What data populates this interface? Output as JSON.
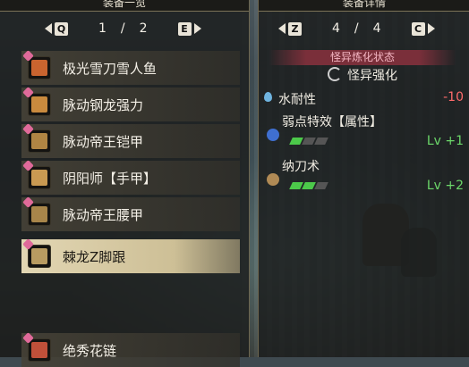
{
  "left_panel": {
    "title": "装备一览",
    "page_key_left": "Q",
    "page_key_right": "E",
    "page_current": "1",
    "page_sep": "/",
    "page_total": "2",
    "items": [
      {
        "label": "极光雪刀雪人鱼",
        "icon": "long-sword-icon",
        "color": "#c9642f"
      },
      {
        "label": "脉动钢龙强力",
        "icon": "helmet-icon",
        "color": "#c98a3e"
      },
      {
        "label": "脉动帝王铠甲",
        "icon": "chest-armor-icon",
        "color": "#b08544"
      },
      {
        "label": "阴阳师【手甲】",
        "icon": "gauntlet-icon",
        "color": "#c99a52"
      },
      {
        "label": "脉动帝王腰甲",
        "icon": "waist-armor-icon",
        "color": "#a8854a"
      },
      {
        "label": "棘龙Z脚跟",
        "icon": "leg-armor-icon",
        "color": "#b89b61"
      },
      {
        "label": "绝秀花链",
        "icon": "charm-icon",
        "color": "#c0503a"
      }
    ],
    "selected_index": 5
  },
  "right_panel": {
    "title": "装备详情",
    "page_key_left": "Z",
    "page_key_right": "C",
    "page_current": "4",
    "page_sep": "/",
    "page_total": "4",
    "status_caption": "怪异炼化状态",
    "mod_label": "怪异强化",
    "water_res_label": "水耐性",
    "water_res_value": "-10",
    "skills": [
      {
        "name": "弱点特效【属性】",
        "level": "Lv +1",
        "filled": 1,
        "total": 3,
        "icon": "bug-icon",
        "icon_color": "#3f6fd0"
      },
      {
        "name": "纳刀术",
        "level": "Lv +2",
        "filled": 2,
        "total": 3,
        "icon": "sheathe-icon",
        "icon_color": "#b08a55"
      }
    ]
  },
  "colors": {
    "accent_green": "#4cc94a",
    "level_text": "#6cd86a",
    "negative": "#ff6b6b",
    "caption_bg": "#7a2f3a",
    "selected_bg": "#e2d6b3"
  }
}
